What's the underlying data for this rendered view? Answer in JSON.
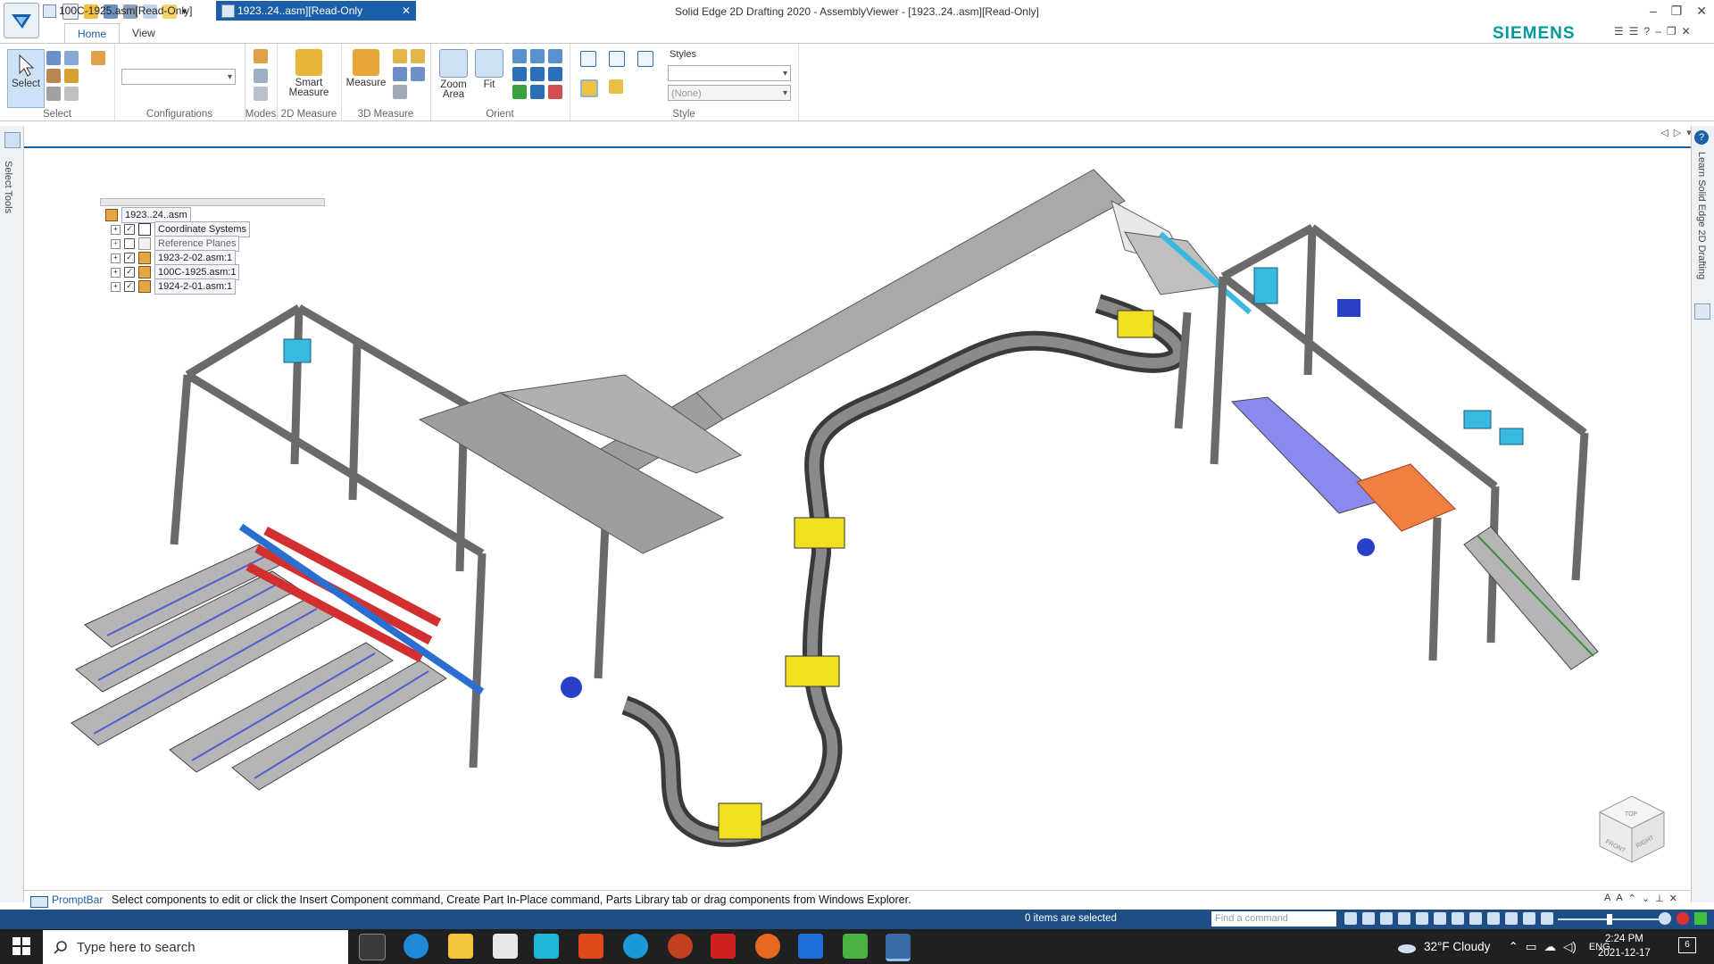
{
  "window": {
    "title": "Solid Edge 2D Drafting 2020 - AssemblyViewer - [1923..24..asm][Read-Only]",
    "brand": "SIEMENS"
  },
  "ribbon": {
    "tabs": [
      "Home",
      "View"
    ],
    "active_tab": "Home",
    "groups": {
      "select": {
        "label": "Select",
        "select_button": "Select"
      },
      "configurations": {
        "label": "Configurations",
        "combo_value": ""
      },
      "modes": {
        "label": "Modes"
      },
      "measure2d": {
        "label": "2D Measure",
        "smart_measure": "Smart Measure"
      },
      "measure3d": {
        "label": "3D Measure",
        "measure": "Measure"
      },
      "orient": {
        "label": "Orient",
        "zoom_area": "Zoom Area",
        "fit": "Fit"
      },
      "style": {
        "label": "Style",
        "styles_label": "Styles",
        "style_combo": "",
        "none_combo": "(None)"
      }
    }
  },
  "doc_tabs": [
    {
      "label": "100C-1925.asm[Read-Only]",
      "active": false
    },
    {
      "label": "1923..24..asm][Read-Only",
      "active": true
    }
  ],
  "side_panels": {
    "left": "Select Tools",
    "right": "Learn Solid Edge 2D Drafting"
  },
  "tree": {
    "root": "1923..24..asm",
    "nodes": [
      {
        "label": "Coordinate Systems",
        "checked": true
      },
      {
        "label": "Reference Planes",
        "checked": false
      },
      {
        "label": "1923-2-02.asm:1",
        "checked": true
      },
      {
        "label": "100C-1925.asm:1",
        "checked": true
      },
      {
        "label": "1924-2-01.asm:1",
        "checked": true
      }
    ]
  },
  "view_cube": {
    "top": "TOP",
    "front": "FRONT",
    "right": "RIGHT"
  },
  "promptbar": {
    "title": "PromptBar",
    "message": "Select components to edit or click the Insert Component command, Create Part In-Place command, Parts Library tab or drag components from Windows Explorer."
  },
  "status": {
    "selection": "0 items are selected",
    "find_placeholder": "Find a command"
  },
  "taskbar": {
    "search_placeholder": "Type here to search",
    "weather": "32°F  Cloudy",
    "language": "ENG",
    "time": "2:24 PM",
    "date": "2021-12-17",
    "notification_count": "6"
  },
  "colors": {
    "accent": "#1a5fa8",
    "statusbar": "#1f4e86",
    "brand": "#009999",
    "frame": "#9a9a9a",
    "belt": "#7d7d7d",
    "cyan_part": "#39b8e0",
    "yellow_part": "#f0e020",
    "blue_part": "#2a3fc8",
    "red_part": "#d23030"
  }
}
